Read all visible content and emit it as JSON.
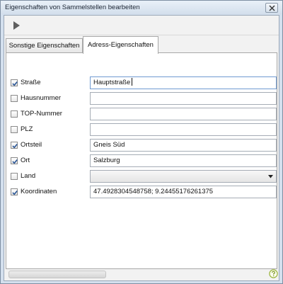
{
  "window": {
    "title": "Eigenschaften von Sammelstellen bearbeiten",
    "close_icon": "close-icon"
  },
  "toolbar": {
    "run_icon": "play-icon"
  },
  "tabs": [
    {
      "label": "Sonstige Eigenschaften",
      "active": false
    },
    {
      "label": "Adress-Eigenschaften",
      "active": true
    }
  ],
  "fields": [
    {
      "label": "Straße",
      "checked": true,
      "value": "Hauptstraße",
      "type": "text",
      "focused": true
    },
    {
      "label": "Hausnummer",
      "checked": false,
      "value": "",
      "type": "text"
    },
    {
      "label": "TOP-Nummer",
      "checked": false,
      "value": "",
      "type": "text"
    },
    {
      "label": "PLZ",
      "checked": false,
      "value": "",
      "type": "text"
    },
    {
      "label": "Ortsteil",
      "checked": true,
      "value": "Gneis Süd",
      "type": "text"
    },
    {
      "label": "Ort",
      "checked": true,
      "value": "Salzburg",
      "type": "text"
    },
    {
      "label": "Land",
      "checked": false,
      "value": "",
      "type": "select"
    },
    {
      "label": "Koordinaten",
      "checked": true,
      "value": "47.4928304548758; 9.24455176261375",
      "type": "text"
    }
  ],
  "footer": {
    "help_icon": "help-icon"
  },
  "colors": {
    "accent_check": "#2b5797",
    "window_frame": "#d4e0ee",
    "help_green": "#9ab43c"
  }
}
